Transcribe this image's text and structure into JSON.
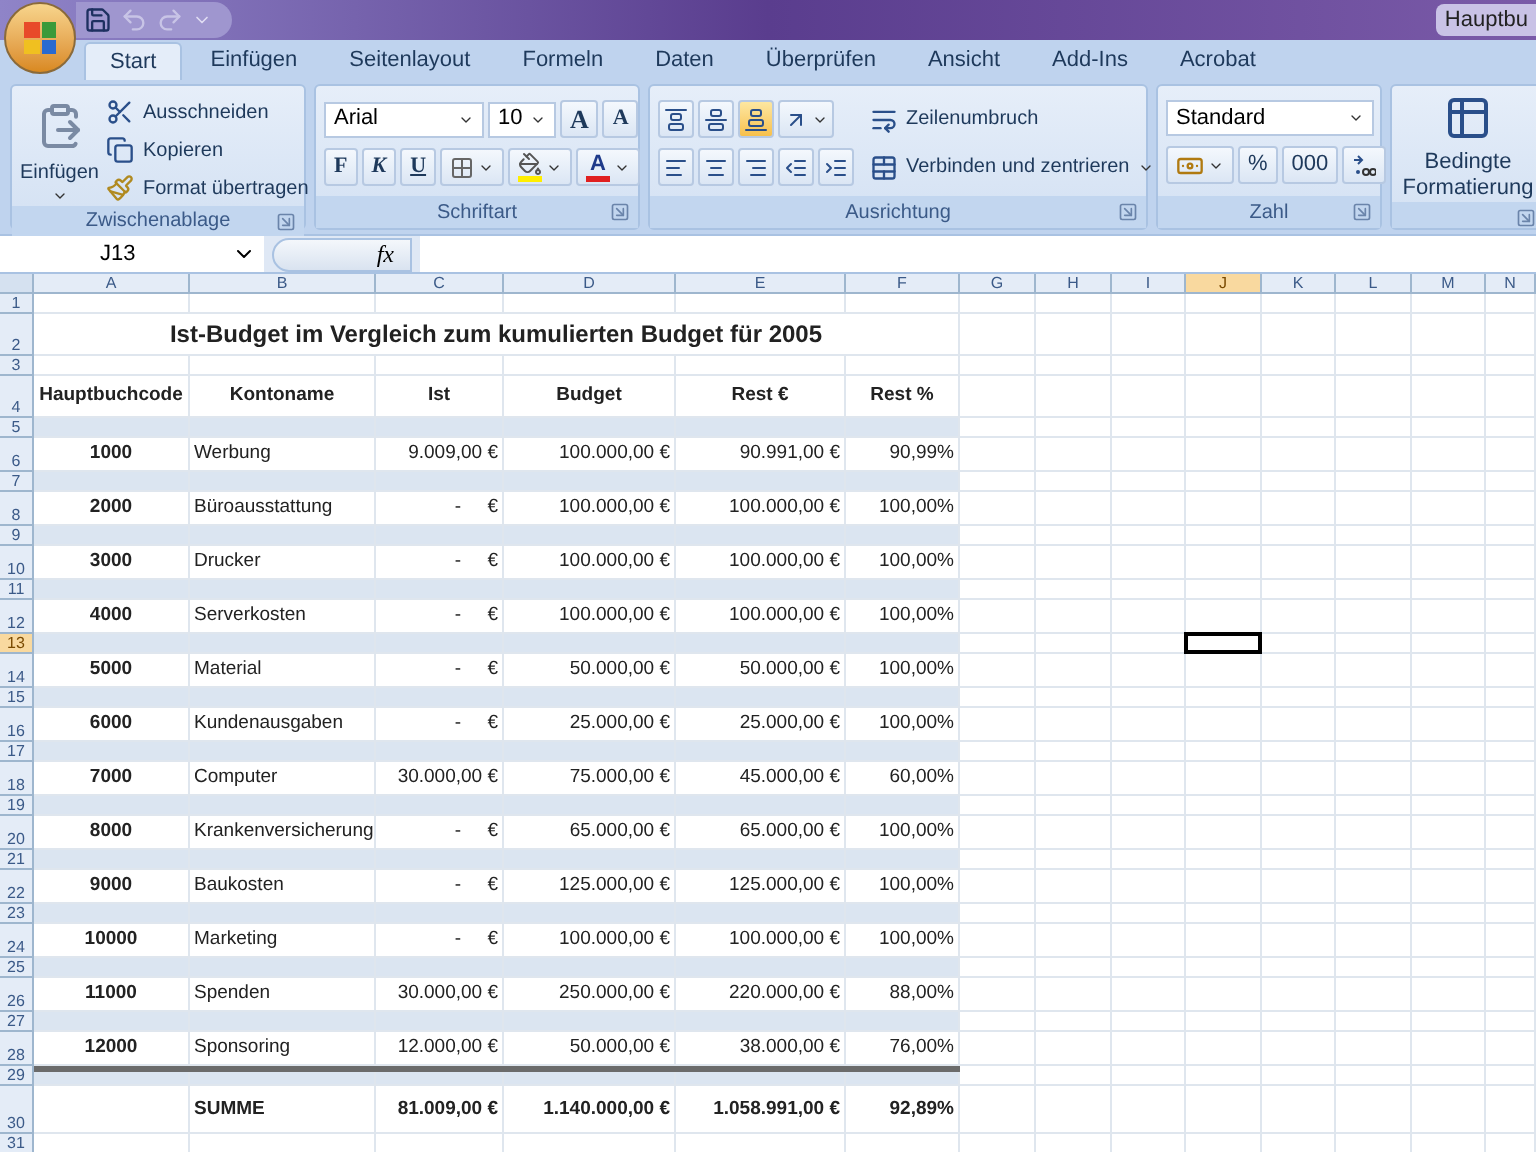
{
  "window": {
    "title": "Hauptbu"
  },
  "ribbon_tabs": [
    {
      "label": "Start",
      "selected": true
    },
    {
      "label": "Einfügen",
      "selected": false
    },
    {
      "label": "Seitenlayout",
      "selected": false
    },
    {
      "label": "Formeln",
      "selected": false
    },
    {
      "label": "Daten",
      "selected": false
    },
    {
      "label": "Überprüfen",
      "selected": false
    },
    {
      "label": "Ansicht",
      "selected": false
    },
    {
      "label": "Add-Ins",
      "selected": false
    },
    {
      "label": "Acrobat",
      "selected": false
    }
  ],
  "clipboard": {
    "title": "Zwischenablage",
    "paste": "Einfügen",
    "cut": "Ausschneiden",
    "copy": "Kopieren",
    "format_painter": "Format übertragen"
  },
  "font": {
    "title": "Schriftart",
    "font_name": "Arial",
    "font_size": "10",
    "grow": "A",
    "shrink": "A",
    "bold": "F",
    "italic": "K",
    "underline": "U",
    "font_color": "A"
  },
  "alignment": {
    "title": "Ausrichtung",
    "wrap": "Zeilenumbruch",
    "merge": "Verbinden und zentrieren"
  },
  "number": {
    "title": "Zahl",
    "format": "Standard",
    "percent": "%",
    "thousands": "000"
  },
  "styles": {
    "conditional": "Bedingte Formatierung"
  },
  "formula_bar": {
    "name_box": "J13",
    "fx": "fx"
  },
  "columns": [
    {
      "label": "A",
      "selected": false
    },
    {
      "label": "B",
      "selected": false
    },
    {
      "label": "C",
      "selected": false
    },
    {
      "label": "D",
      "selected": false
    },
    {
      "label": "E",
      "selected": false
    },
    {
      "label": "F",
      "selected": false
    },
    {
      "label": "G",
      "selected": false
    },
    {
      "label": "H",
      "selected": false
    },
    {
      "label": "I",
      "selected": false
    },
    {
      "label": "J",
      "selected": true
    },
    {
      "label": "K",
      "selected": false
    },
    {
      "label": "L",
      "selected": false
    },
    {
      "label": "M",
      "selected": false
    },
    {
      "label": "N",
      "selected": false
    }
  ],
  "rows": [
    {
      "number": "1",
      "kind": "blank",
      "selected": false
    },
    {
      "number": "2",
      "kind": "title",
      "selected": false,
      "text": "Ist-Budget im Vergleich zum kumulierten Budget für 2005"
    },
    {
      "number": "3",
      "kind": "blank",
      "selected": false
    },
    {
      "number": "4",
      "kind": "header",
      "selected": false,
      "cells": [
        "Hauptbuchcode",
        "Kontoname",
        "Ist",
        "Budget",
        "Rest €",
        "Rest %"
      ]
    },
    {
      "number": "5",
      "kind": "spacer",
      "selected": false
    },
    {
      "number": "6",
      "kind": "data",
      "selected": false,
      "cells": [
        "1000",
        "Werbung",
        "9.009,00 €",
        "100.000,00 €",
        "90.991,00 €",
        "90,99%"
      ]
    },
    {
      "number": "7",
      "kind": "spacer",
      "selected": false
    },
    {
      "number": "8",
      "kind": "data",
      "selected": false,
      "cells": [
        "2000",
        "Büroausstattung",
        "-     €",
        "100.000,00 €",
        "100.000,00 €",
        "100,00%"
      ]
    },
    {
      "number": "9",
      "kind": "spacer",
      "selected": false
    },
    {
      "number": "10",
      "kind": "data",
      "selected": false,
      "cells": [
        "3000",
        "Drucker",
        "-     €",
        "100.000,00 €",
        "100.000,00 €",
        "100,00%"
      ]
    },
    {
      "number": "11",
      "kind": "spacer",
      "selected": false
    },
    {
      "number": "12",
      "kind": "data",
      "selected": false,
      "cells": [
        "4000",
        "Serverkosten",
        "-     €",
        "100.000,00 €",
        "100.000,00 €",
        "100,00%"
      ]
    },
    {
      "number": "13",
      "kind": "spacer",
      "selected": true
    },
    {
      "number": "14",
      "kind": "data",
      "selected": false,
      "cells": [
        "5000",
        "Material",
        "-     €",
        "50.000,00 €",
        "50.000,00 €",
        "100,00%"
      ]
    },
    {
      "number": "15",
      "kind": "spacer",
      "selected": false
    },
    {
      "number": "16",
      "kind": "data",
      "selected": false,
      "cells": [
        "6000",
        "Kundenausgaben",
        "-     €",
        "25.000,00 €",
        "25.000,00 €",
        "100,00%"
      ]
    },
    {
      "number": "17",
      "kind": "spacer",
      "selected": false
    },
    {
      "number": "18",
      "kind": "data",
      "selected": false,
      "cells": [
        "7000",
        "Computer",
        "30.000,00 €",
        "75.000,00 €",
        "45.000,00 €",
        "60,00%"
      ]
    },
    {
      "number": "19",
      "kind": "spacer",
      "selected": false
    },
    {
      "number": "20",
      "kind": "data",
      "selected": false,
      "cells": [
        "8000",
        "Krankenversicherung",
        "-     €",
        "65.000,00 €",
        "65.000,00 €",
        "100,00%"
      ]
    },
    {
      "number": "21",
      "kind": "spacer",
      "selected": false
    },
    {
      "number": "22",
      "kind": "data",
      "selected": false,
      "cells": [
        "9000",
        "Baukosten",
        "-     €",
        "125.000,00 €",
        "125.000,00 €",
        "100,00%"
      ]
    },
    {
      "number": "23",
      "kind": "spacer",
      "selected": false
    },
    {
      "number": "24",
      "kind": "data",
      "selected": false,
      "cells": [
        "10000",
        "Marketing",
        "-     €",
        "100.000,00 €",
        "100.000,00 €",
        "100,00%"
      ]
    },
    {
      "number": "25",
      "kind": "spacer",
      "selected": false
    },
    {
      "number": "26",
      "kind": "data",
      "selected": false,
      "cells": [
        "11000",
        "Spenden",
        "30.000,00 €",
        "250.000,00 €",
        "220.000,00 €",
        "88,00%"
      ]
    },
    {
      "number": "27",
      "kind": "spacer",
      "selected": false
    },
    {
      "number": "28",
      "kind": "data",
      "selected": false,
      "cells": [
        "12000",
        "Sponsoring",
        "12.000,00 €",
        "50.000,00 €",
        "38.000,00 €",
        "76,00%"
      ]
    },
    {
      "number": "29",
      "kind": "rule_spacer",
      "selected": false
    },
    {
      "number": "30",
      "kind": "total",
      "selected": false,
      "cells": [
        "SUMME",
        "81.009,00 €",
        "1.140.000,00 €",
        "1.058.991,00 €",
        "92,89%"
      ]
    },
    {
      "number": "31",
      "kind": "blank",
      "selected": false
    }
  ]
}
